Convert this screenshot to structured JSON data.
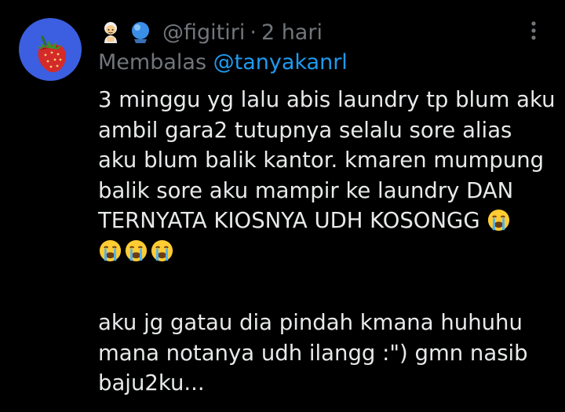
{
  "tweet": {
    "avatar_icon": "strawberry-icon",
    "header": {
      "emoji_1": "genie-emoji-icon",
      "emoji_2": "crystal-ball-emoji-icon",
      "handle": "@figitiri",
      "separator": "·",
      "time": "2 hari",
      "more_icon": "more-vertical-icon"
    },
    "reply": {
      "prefix": "Membalas",
      "mention": "@tanyakanrl"
    },
    "body": {
      "lines_p1": [
        "3 minggu yg lalu abis laundry tp blum aku",
        "ambil gara2 tutupnya selalu sore alias",
        "aku blum balik kantor. kmaren mumpung",
        "balik sore aku mampir ke laundry DAN",
        "TERNYATA KIOSNYA UDH KOSONGG"
      ],
      "emoji_after_p1": "loudly-crying-face-icon",
      "emoji_row": [
        "loudly-crying-face-icon",
        "loudly-crying-face-icon",
        "loudly-crying-face-icon"
      ],
      "lines_p2": [
        "aku jg gatau dia pindah kmana huhuhu",
        "mana notanya udh ilangg :\") gmn nasib",
        "baju2ku..."
      ]
    }
  },
  "colors": {
    "background": "#000000",
    "text": "#e7e9ea",
    "muted": "#71767b",
    "accent": "#1d9bf0",
    "avatar_bg": "#3b5fe0"
  }
}
